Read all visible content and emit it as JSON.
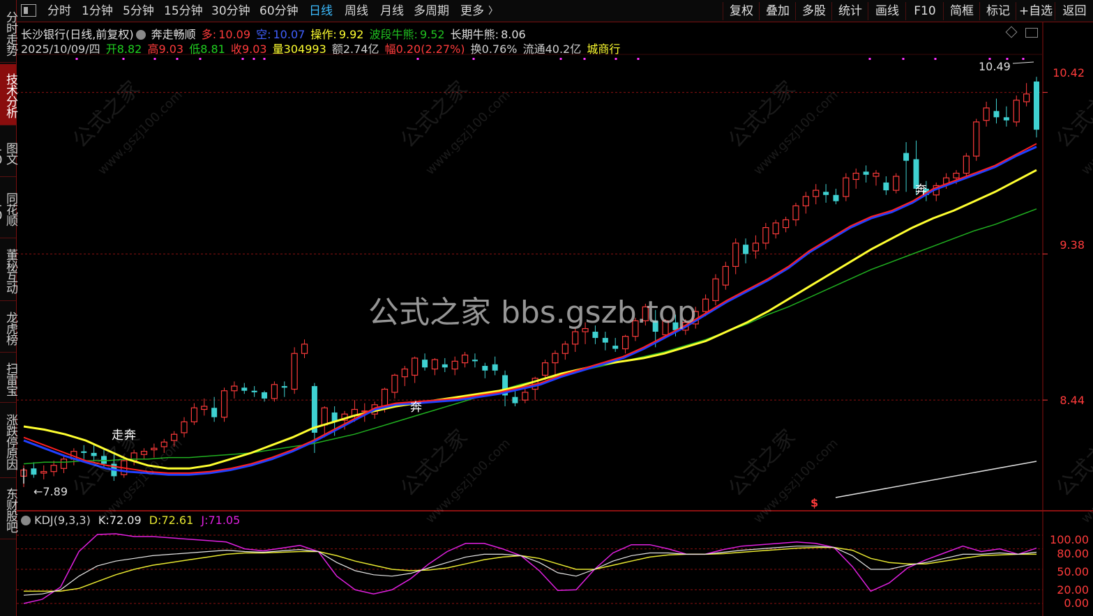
{
  "toolbar": {
    "tabs": [
      "分时",
      "1分钟",
      "5分钟",
      "15分钟",
      "30分钟",
      "60分钟",
      "日线",
      "周线",
      "月线",
      "多周期",
      "更多"
    ],
    "active_tab": "日线",
    "more_arrow": "〉",
    "buttons": [
      "复权",
      "叠加",
      "多股",
      "统计",
      "画线",
      "F10",
      "简框",
      "标记",
      "+自选",
      "返回"
    ]
  },
  "sidebar": {
    "items": [
      "分时走势",
      "技术分析",
      "图文10",
      "同花顺10",
      "董秘互动",
      "龙虎榜",
      "扫雷宝",
      "涨跌停原因",
      "东财股吧"
    ],
    "active_index": 1
  },
  "header": {
    "name": "长沙银行(日线,前复权)",
    "formula": "奔走畅顺",
    "duo_label": "多:",
    "duo_value": "10.09",
    "kong_label": "空:",
    "kong_value": "10.07",
    "caozuo_label": "操作:",
    "caozuo_value": "9.92",
    "boduan_label": "波段牛熊:",
    "boduan_value": "9.52",
    "changqi_label": "长期牛熊:",
    "changqi_value": "8.06",
    "date": "2025/10/09/四",
    "open_label": "开",
    "open": "8.82",
    "high_label": "高",
    "high": "9.03",
    "low_label": "低",
    "low": "8.81",
    "close_label": "收",
    "close": "9.03",
    "vol_label": "量",
    "volume": "304993",
    "amt_label": "额",
    "amount": "2.74亿",
    "chg_label": "幅",
    "change": "0.20(2.27%)",
    "turn_label": "换",
    "turnover": "0.76%",
    "float_label": "流通",
    "float_cap": "40.2亿",
    "sector": "城商行"
  },
  "price_axis": [
    "10.42",
    "9.38",
    "8.44"
  ],
  "kdj": {
    "title": "KDJ(9,3,3)",
    "k_label": "K:",
    "k": "72.09",
    "d_label": "D:",
    "d": "72.61",
    "j_label": "J:",
    "j": "71.05",
    "axis": [
      "100.00",
      "80.00",
      "50.00",
      "20.00",
      "0.00"
    ]
  },
  "annotations": {
    "high_mark": "10.49",
    "low_mark": "←7.89",
    "signal_1": "走",
    "signal_2": "奔",
    "signal_3": "奔",
    "signal_4": "奔",
    "dollar": "$"
  },
  "watermark": {
    "center": "公式之家 bbs.gszb.top",
    "diag_main": "公式之家",
    "diag_url": "www.gszj100.com"
  },
  "colors": {
    "up": "#ff3b3b",
    "down": "#3fd1d1",
    "ma_red": "#ff2020",
    "ma_blue": "#2040ff",
    "ma_yellow": "#ffff30",
    "ma_green": "#20b020",
    "k": "#e8e8e8",
    "d": "#e8e830",
    "j": "#e020e0"
  },
  "chart_data": {
    "type": "candlestick",
    "candles": [
      [
        7.95,
        8.02,
        7.88,
        7.99
      ],
      [
        8.0,
        8.04,
        7.94,
        7.96
      ],
      [
        7.97,
        8.02,
        7.93,
        7.98
      ],
      [
        7.98,
        8.05,
        7.95,
        8.02
      ],
      [
        8.0,
        8.08,
        7.97,
        8.06
      ],
      [
        8.06,
        8.13,
        8.02,
        8.11
      ],
      [
        8.11,
        8.15,
        8.06,
        8.1
      ],
      [
        8.1,
        8.15,
        8.05,
        8.08
      ],
      [
        8.08,
        8.12,
        8.01,
        8.03
      ],
      [
        8.03,
        8.09,
        7.92,
        7.95
      ],
      [
        7.96,
        8.08,
        7.94,
        8.05
      ],
      [
        8.05,
        8.12,
        8.02,
        8.1
      ],
      [
        8.09,
        8.13,
        8.06,
        8.11
      ],
      [
        8.12,
        8.16,
        8.07,
        8.13
      ],
      [
        8.14,
        8.19,
        8.1,
        8.17
      ],
      [
        8.18,
        8.24,
        8.14,
        8.22
      ],
      [
        8.23,
        8.33,
        8.2,
        8.3
      ],
      [
        8.3,
        8.42,
        8.28,
        8.39
      ],
      [
        8.38,
        8.45,
        8.34,
        8.4
      ],
      [
        8.39,
        8.46,
        8.3,
        8.33
      ],
      [
        8.33,
        8.52,
        8.3,
        8.5
      ],
      [
        8.5,
        8.56,
        8.45,
        8.53
      ],
      [
        8.52,
        8.55,
        8.48,
        8.5
      ],
      [
        8.5,
        8.53,
        8.46,
        8.49
      ],
      [
        8.49,
        8.5,
        8.43,
        8.45
      ],
      [
        8.45,
        8.56,
        8.43,
        8.54
      ],
      [
        8.53,
        8.56,
        8.46,
        8.52
      ],
      [
        8.51,
        8.78,
        8.48,
        8.74
      ],
      [
        8.74,
        8.83,
        8.71,
        8.8
      ],
      [
        8.53,
        8.55,
        8.1,
        8.23
      ],
      [
        8.28,
        8.4,
        8.2,
        8.39
      ],
      [
        8.36,
        8.4,
        8.21,
        8.3
      ],
      [
        8.31,
        8.37,
        8.25,
        8.35
      ],
      [
        8.34,
        8.44,
        8.3,
        8.38
      ],
      [
        8.37,
        8.42,
        8.3,
        8.37
      ],
      [
        8.35,
        8.43,
        8.32,
        8.41
      ],
      [
        8.39,
        8.52,
        8.36,
        8.51
      ],
      [
        8.49,
        8.61,
        8.45,
        8.6
      ],
      [
        8.59,
        8.66,
        8.53,
        8.64
      ],
      [
        8.6,
        8.72,
        8.55,
        8.71
      ],
      [
        8.7,
        8.74,
        8.63,
        8.65
      ],
      [
        8.64,
        8.71,
        8.6,
        8.7
      ],
      [
        8.67,
        8.71,
        8.62,
        8.65
      ],
      [
        8.64,
        8.72,
        8.6,
        8.69
      ],
      [
        8.68,
        8.75,
        8.65,
        8.73
      ],
      [
        8.7,
        8.74,
        8.65,
        8.69
      ],
      [
        8.66,
        8.68,
        8.58,
        8.63
      ],
      [
        8.67,
        8.72,
        8.6,
        8.63
      ],
      [
        8.6,
        8.63,
        8.4,
        8.47
      ],
      [
        8.46,
        8.53,
        8.4,
        8.42
      ],
      [
        8.44,
        8.52,
        8.42,
        8.49
      ],
      [
        8.51,
        8.59,
        8.44,
        8.58
      ],
      [
        8.6,
        8.7,
        8.57,
        8.68
      ],
      [
        8.68,
        8.76,
        8.6,
        8.74
      ],
      [
        8.74,
        8.82,
        8.7,
        8.8
      ],
      [
        8.8,
        8.9,
        8.75,
        8.88
      ],
      [
        8.88,
        8.94,
        8.8,
        8.9
      ],
      [
        8.88,
        8.92,
        8.8,
        8.84
      ],
      [
        8.84,
        8.88,
        8.76,
        8.81
      ],
      [
        8.79,
        8.84,
        8.75,
        8.77
      ],
      [
        8.77,
        8.86,
        8.74,
        8.85
      ],
      [
        8.85,
        8.97,
        8.82,
        8.95
      ],
      [
        8.95,
        9.06,
        8.92,
        9.04
      ],
      [
        8.95,
        9.02,
        8.78,
        8.88
      ],
      [
        8.86,
        8.96,
        8.84,
        8.95
      ],
      [
        8.94,
        8.99,
        8.85,
        8.89
      ],
      [
        8.89,
        8.96,
        8.86,
        8.94
      ],
      [
        8.93,
        9.04,
        8.9,
        9.01
      ],
      [
        9.01,
        9.12,
        8.98,
        9.09
      ],
      [
        9.08,
        9.25,
        9.05,
        9.22
      ],
      [
        9.18,
        9.33,
        9.15,
        9.3
      ],
      [
        9.3,
        9.48,
        9.25,
        9.45
      ],
      [
        9.44,
        9.48,
        9.32,
        9.38
      ],
      [
        9.4,
        9.5,
        9.35,
        9.45
      ],
      [
        9.45,
        9.58,
        9.41,
        9.55
      ],
      [
        9.51,
        9.6,
        9.48,
        9.58
      ],
      [
        9.55,
        9.62,
        9.52,
        9.6
      ],
      [
        9.6,
        9.71,
        9.56,
        9.69
      ],
      [
        9.69,
        9.78,
        9.64,
        9.75
      ],
      [
        9.75,
        9.83,
        9.7,
        9.79
      ],
      [
        9.78,
        9.83,
        9.71,
        9.76
      ],
      [
        9.76,
        9.8,
        9.7,
        9.72
      ],
      [
        9.75,
        9.9,
        9.72,
        9.87
      ],
      [
        9.86,
        9.93,
        9.8,
        9.9
      ],
      [
        9.91,
        9.95,
        9.84,
        9.89
      ],
      [
        9.88,
        9.92,
        9.82,
        9.9
      ],
      [
        9.84,
        9.88,
        9.76,
        9.79
      ],
      [
        9.79,
        9.9,
        9.77,
        9.88
      ],
      [
        10.03,
        10.1,
        9.78,
        9.98
      ],
      [
        9.99,
        10.11,
        9.76,
        9.8
      ],
      [
        9.8,
        9.85,
        9.72,
        9.76
      ],
      [
        9.76,
        9.84,
        9.72,
        9.82
      ],
      [
        9.83,
        9.9,
        9.8,
        9.87
      ],
      [
        9.87,
        9.92,
        9.83,
        9.9
      ],
      [
        9.9,
        10.03,
        9.87,
        10.01
      ],
      [
        10.01,
        10.25,
        9.98,
        10.23
      ],
      [
        10.24,
        10.36,
        10.2,
        10.32
      ],
      [
        10.3,
        10.38,
        10.22,
        10.26
      ],
      [
        10.26,
        10.33,
        10.2,
        10.24
      ],
      [
        10.23,
        10.4,
        10.2,
        10.37
      ],
      [
        10.36,
        10.48,
        10.33,
        10.41
      ],
      [
        10.49,
        10.52,
        10.13,
        10.18
      ]
    ],
    "ma_red": [
      8.2,
      8.15,
      8.1,
      8.05,
      8.02,
      8.0,
      7.98,
      7.97,
      7.97,
      7.98,
      8.0,
      8.03,
      8.07,
      8.12,
      8.18,
      8.25,
      8.32,
      8.39,
      8.42,
      8.43,
      8.44,
      8.45,
      8.47,
      8.49,
      8.52,
      8.55,
      8.6,
      8.64,
      8.68,
      8.72,
      8.78,
      8.85,
      8.92,
      9.0,
      9.08,
      9.15,
      9.22,
      9.3,
      9.4,
      9.48,
      9.56,
      9.62,
      9.66,
      9.72,
      9.8,
      9.85,
      9.9,
      9.95,
      10.02,
      10.09
    ],
    "ma_blue": [
      8.18,
      8.13,
      8.08,
      8.04,
      8.0,
      7.98,
      7.97,
      7.96,
      7.96,
      7.97,
      7.99,
      8.02,
      8.06,
      8.11,
      8.17,
      8.24,
      8.31,
      8.38,
      8.41,
      8.42,
      8.43,
      8.44,
      8.46,
      8.48,
      8.51,
      8.54,
      8.59,
      8.63,
      8.67,
      8.71,
      8.77,
      8.84,
      8.91,
      8.99,
      9.07,
      9.14,
      9.21,
      9.29,
      9.39,
      9.47,
      9.55,
      9.61,
      9.65,
      9.71,
      9.79,
      9.84,
      9.89,
      9.94,
      10.01,
      10.07
    ],
    "ma_yellow": [
      8.27,
      8.25,
      8.22,
      8.18,
      8.12,
      8.06,
      8.02,
      8.0,
      8.0,
      8.02,
      8.06,
      8.1,
      8.15,
      8.2,
      8.26,
      8.3,
      8.34,
      8.37,
      8.4,
      8.42,
      8.44,
      8.46,
      8.48,
      8.5,
      8.53,
      8.57,
      8.61,
      8.64,
      8.67,
      8.69,
      8.71,
      8.74,
      8.78,
      8.82,
      8.88,
      8.94,
      9.01,
      9.09,
      9.17,
      9.25,
      9.33,
      9.41,
      9.48,
      9.55,
      9.61,
      9.66,
      9.72,
      9.78,
      9.85,
      9.92
    ],
    "ma_green": [
      8.03,
      8.04,
      8.04,
      8.05,
      8.05,
      8.06,
      8.06,
      8.07,
      8.07,
      8.08,
      8.09,
      8.1,
      8.12,
      8.14,
      8.16,
      8.19,
      8.22,
      8.26,
      8.3,
      8.34,
      8.38,
      8.42,
      8.46,
      8.5,
      8.54,
      8.57,
      8.6,
      8.63,
      8.66,
      8.69,
      8.72,
      8.75,
      8.79,
      8.83,
      8.88,
      8.93,
      8.99,
      9.04,
      9.1,
      9.16,
      9.22,
      9.28,
      9.33,
      9.38,
      9.43,
      9.48,
      9.53,
      9.57,
      9.62,
      9.67
    ],
    "long_line": [
      7.8,
      8.06
    ],
    "kdj_k": [
      12,
      14,
      20,
      40,
      55,
      62,
      66,
      70,
      72,
      74,
      76,
      78,
      76,
      75,
      77,
      79,
      76,
      60,
      48,
      42,
      40,
      44,
      52,
      60,
      68,
      72,
      72,
      70,
      60,
      45,
      40,
      50,
      62,
      70,
      74,
      74,
      72,
      72,
      75,
      78,
      80,
      82,
      84,
      84,
      82,
      70,
      50,
      50,
      56,
      60,
      66,
      72,
      72,
      74,
      72,
      75
    ],
    "kdj_d": [
      18,
      18,
      18,
      22,
      32,
      42,
      50,
      56,
      60,
      64,
      68,
      72,
      74,
      74,
      75,
      76,
      76,
      70,
      62,
      56,
      50,
      48,
      49,
      52,
      58,
      64,
      68,
      70,
      66,
      58,
      50,
      50,
      56,
      62,
      68,
      71,
      72,
      72,
      73,
      75,
      77,
      79,
      81,
      82,
      82,
      78,
      66,
      60,
      58,
      58,
      62,
      66,
      70,
      71,
      72,
      72
    ],
    "kdj_j": [
      0,
      6,
      24,
      76,
      101,
      102,
      98,
      98,
      96,
      94,
      92,
      90,
      80,
      77,
      81,
      85,
      76,
      40,
      20,
      14,
      20,
      36,
      58,
      76,
      88,
      88,
      80,
      70,
      48,
      19,
      20,
      50,
      74,
      86,
      86,
      80,
      72,
      72,
      79,
      84,
      86,
      88,
      90,
      88,
      82,
      54,
      18,
      30,
      52,
      64,
      74,
      84,
      76,
      80,
      72,
      81
    ]
  }
}
